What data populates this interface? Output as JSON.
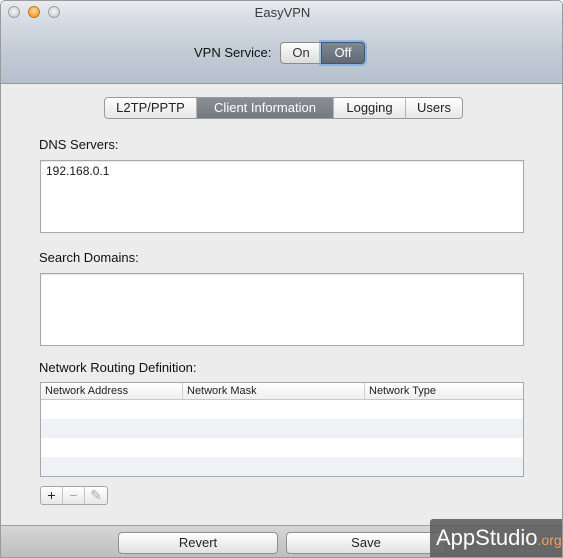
{
  "window": {
    "title": "EasyVPN"
  },
  "toolbar": {
    "service_label": "VPN Service:",
    "on_label": "On",
    "off_label": "Off",
    "selected": "Off"
  },
  "tabs": [
    {
      "label": "L2TP/PPTP"
    },
    {
      "label": "Client Information"
    },
    {
      "label": "Logging"
    },
    {
      "label": "Users"
    }
  ],
  "selected_tab": "Client Information",
  "dns": {
    "label": "DNS Servers:",
    "value": "192.168.0.1"
  },
  "search_domains": {
    "label": "Search Domains:",
    "value": ""
  },
  "routing": {
    "label": "Network Routing Definition:",
    "columns": [
      "Network Address",
      "Network Mask",
      "Network Type"
    ],
    "rows": []
  },
  "table_controls": {
    "add": "+",
    "remove": "−",
    "edit": "✎"
  },
  "footer": {
    "revert_label": "Revert",
    "save_label": "Save"
  },
  "watermark": {
    "main": "AppStudio",
    "suffix": ".org"
  }
}
